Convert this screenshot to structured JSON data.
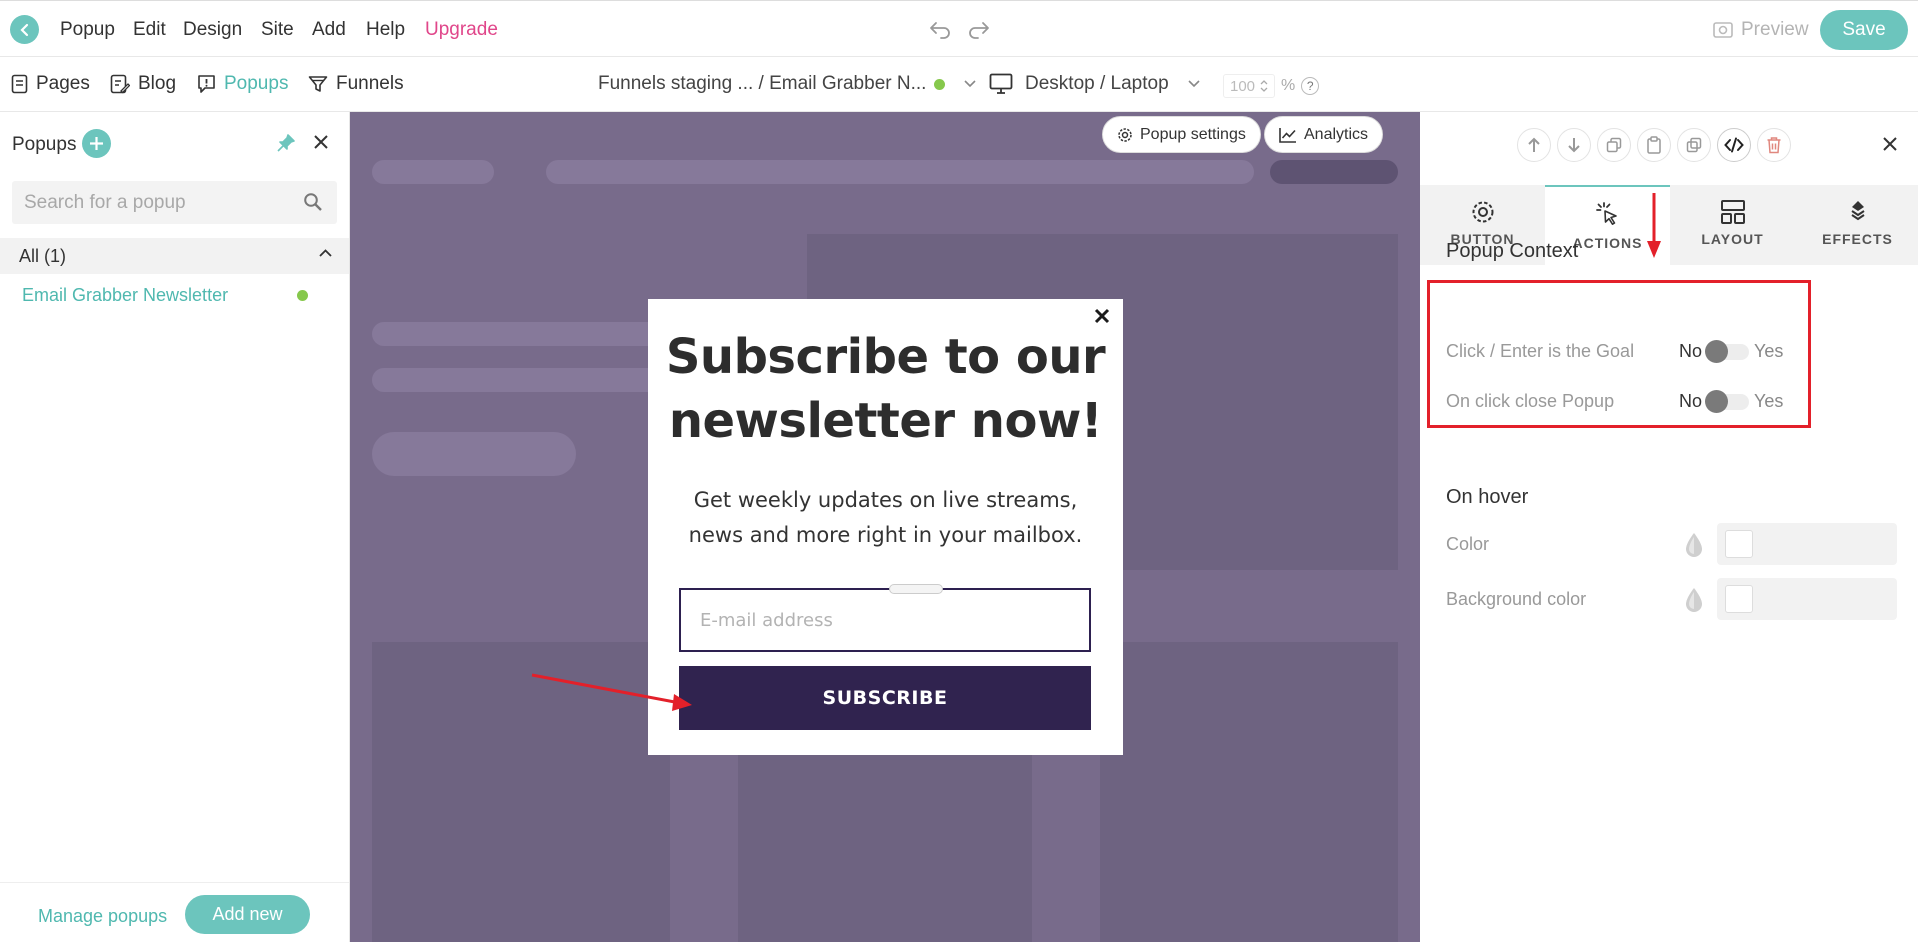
{
  "topbar": {
    "menu": [
      "Popup",
      "Edit",
      "Design",
      "Site",
      "Add",
      "Help",
      "Upgrade"
    ],
    "preview_label": "Preview",
    "save_label": "Save"
  },
  "navbar": {
    "items": [
      {
        "label": "Pages",
        "icon": "page-icon"
      },
      {
        "label": "Blog",
        "icon": "blog-icon"
      },
      {
        "label": "Popups",
        "icon": "popup-icon",
        "active": true
      },
      {
        "label": "Funnels",
        "icon": "funnel-icon"
      }
    ],
    "breadcrumb": "Funnels staging ... / Email Grabber N...",
    "device": "Desktop / Laptop",
    "zoom_value": "100",
    "zoom_unit": "%",
    "help": "?"
  },
  "sidebar": {
    "title": "Popups",
    "search_placeholder": "Search for a popup",
    "group_label": "All (1)",
    "items": [
      {
        "label": "Email Grabber Newsletter",
        "status_color": "#86c84c"
      }
    ],
    "manage_label": "Manage popups",
    "add_new_label": "Add new"
  },
  "canvas": {
    "popup_settings_label": "Popup settings",
    "analytics_label": "Analytics",
    "popup": {
      "heading_line1": "Subscribe to our",
      "heading_line2": "newsletter now!",
      "subtext_line1": "Get weekly updates on live streams,",
      "subtext_line2": "news and more right in your mailbox.",
      "email_placeholder": "E-mail address",
      "submit_label": "SUBSCRIBE",
      "close_glyph": "×"
    }
  },
  "right_panel": {
    "tabs": [
      {
        "label": "BUTTON",
        "icon": "gear-icon"
      },
      {
        "label": "ACTIONS",
        "icon": "cursor-click-icon",
        "active": true
      },
      {
        "label": "LAYOUT",
        "icon": "layout-icon"
      },
      {
        "label": "EFFECTS",
        "icon": "layers-icon"
      }
    ],
    "popup_context": {
      "title": "Popup Context",
      "rows": [
        {
          "label": "Click / Enter is the Goal",
          "no": "No",
          "yes": "Yes",
          "value": false
        },
        {
          "label": "On click close Popup",
          "no": "No",
          "yes": "Yes",
          "value": false
        }
      ]
    },
    "on_hover": {
      "title": "On hover",
      "rows": [
        {
          "label": "Color"
        },
        {
          "label": "Background color"
        }
      ]
    }
  },
  "colors": {
    "accent": "#6cc5bd",
    "upgrade": "#e0468a",
    "canvas_bg": "#786b8b",
    "popup_button": "#30234f",
    "highlight": "#e3202a",
    "status_green": "#86c84c"
  }
}
